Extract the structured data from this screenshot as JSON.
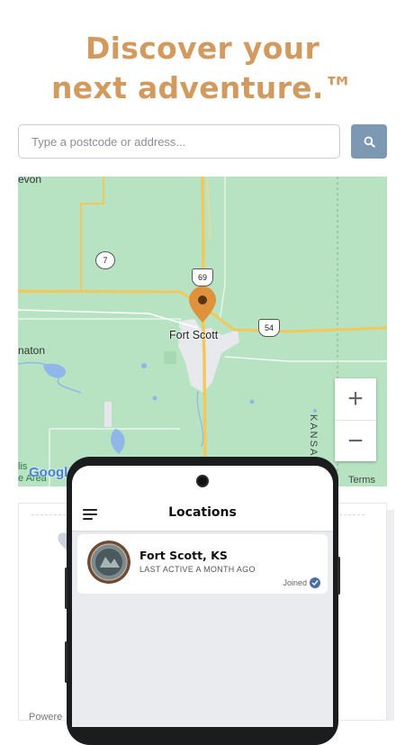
{
  "header": {
    "line1": "Discover your",
    "line2": "next adventure.™"
  },
  "search": {
    "placeholder": "Type a postcode or address...",
    "button_icon": "search-icon"
  },
  "map": {
    "city_label": "Fort Scott",
    "partial_labels": {
      "top_left": "evon",
      "left": "naton",
      "state": "KANSAS",
      "bottom_left_1": "lis",
      "bottom_left_2": "e Area"
    },
    "route_shields": [
      "7",
      "69",
      "54"
    ],
    "zoom_in": "+",
    "zoom_out": "−",
    "terms": "Terms",
    "google_logo": "Google",
    "colors": {
      "land": "#b7e3c3",
      "road": "#f2c85c",
      "pin": "#e0913c"
    }
  },
  "footer": {
    "powered": "Powere"
  },
  "phone": {
    "title": "Locations",
    "menu_icon": "hamburger-icon",
    "locations": [
      {
        "name": "Fort Scott, KS",
        "subtitle": "LAST ACTIVE A MONTH AGO",
        "status": "Joined",
        "status_icon": "check-icon"
      }
    ]
  }
}
